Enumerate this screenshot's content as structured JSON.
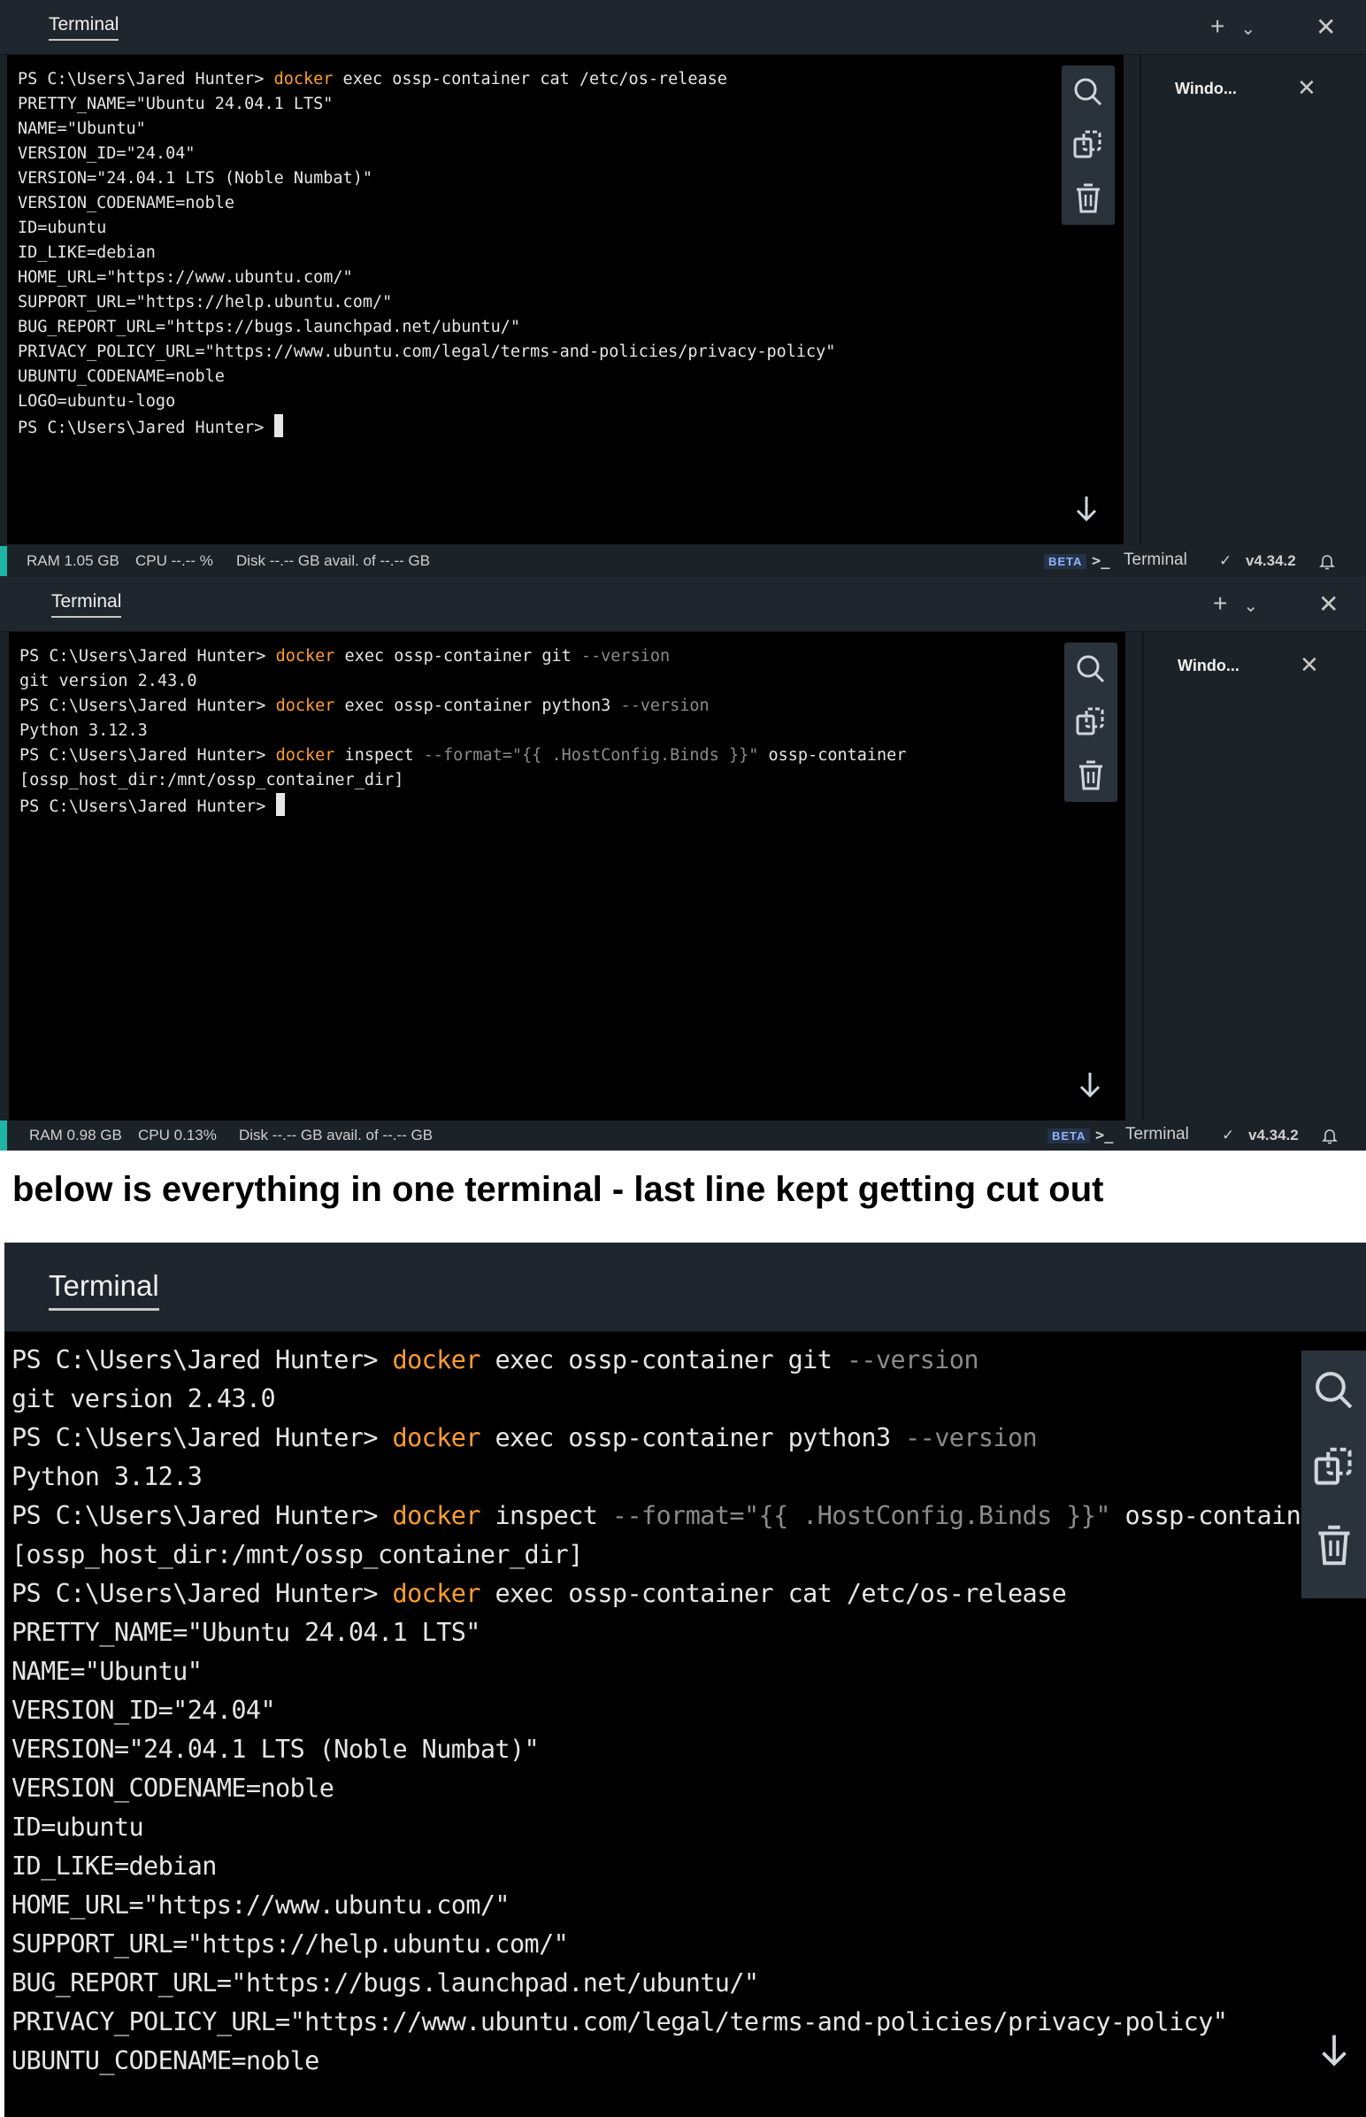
{
  "window1": {
    "tab_title": "Terminal",
    "side_panel_title": "Windo...",
    "lines": [
      [
        {
          "t": "PS C:\\Users\\Jared Hunter> "
        },
        {
          "t": "docker",
          "c": "kw"
        },
        {
          "t": " exec ossp-container cat /etc/os-release"
        }
      ],
      [
        {
          "t": "PRETTY_NAME=\"Ubuntu 24.04.1 LTS\""
        }
      ],
      [
        {
          "t": "NAME=\"Ubuntu\""
        }
      ],
      [
        {
          "t": "VERSION_ID=\"24.04\""
        }
      ],
      [
        {
          "t": "VERSION=\"24.04.1 LTS (Noble Numbat)\""
        }
      ],
      [
        {
          "t": "VERSION_CODENAME=noble"
        }
      ],
      [
        {
          "t": "ID=ubuntu"
        }
      ],
      [
        {
          "t": "ID_LIKE=debian"
        }
      ],
      [
        {
          "t": "HOME_URL=\"https://www.ubuntu.com/\""
        }
      ],
      [
        {
          "t": "SUPPORT_URL=\"https://help.ubuntu.com/\""
        }
      ],
      [
        {
          "t": "BUG_REPORT_URL=\"https://bugs.launchpad.net/ubuntu/\""
        }
      ],
      [
        {
          "t": "PRIVACY_POLICY_URL=\"https://www.ubuntu.com/legal/terms-and-policies/privacy-policy\""
        }
      ],
      [
        {
          "t": "UBUNTU_CODENAME=noble"
        }
      ],
      [
        {
          "t": "LOGO=ubuntu-logo"
        }
      ],
      [
        {
          "t": "PS C:\\Users\\Jared Hunter> "
        },
        {
          "cursor": true
        }
      ]
    ],
    "status": {
      "ram": "RAM 1.05 GB",
      "cpu": "CPU --.-- %",
      "disk": "Disk --.-- GB avail. of --.-- GB",
      "beta": "BETA",
      "terminal": "Terminal",
      "version": "v4.34.2"
    }
  },
  "window2": {
    "tab_title": "Terminal",
    "side_panel_title": "Windo...",
    "lines": [
      [
        {
          "t": "PS C:\\Users\\Jared Hunter> "
        },
        {
          "t": "docker",
          "c": "kw"
        },
        {
          "t": " exec ossp-container git "
        },
        {
          "t": "--version",
          "c": "flag"
        }
      ],
      [
        {
          "t": "git version 2.43.0"
        }
      ],
      [
        {
          "t": "PS C:\\Users\\Jared Hunter> "
        },
        {
          "t": "docker",
          "c": "kw"
        },
        {
          "t": " exec ossp-container python3 "
        },
        {
          "t": "--version",
          "c": "flag"
        }
      ],
      [
        {
          "t": "Python 3.12.3"
        }
      ],
      [
        {
          "t": "PS C:\\Users\\Jared Hunter> "
        },
        {
          "t": "docker",
          "c": "kw"
        },
        {
          "t": " inspect "
        },
        {
          "t": "--format=\"{{ .HostConfig.Binds }}\"",
          "c": "flag"
        },
        {
          "t": " ossp-container"
        }
      ],
      [
        {
          "t": "[ossp_host_dir:/mnt/ossp_container_dir]"
        }
      ],
      [
        {
          "t": "PS C:\\Users\\Jared Hunter> "
        },
        {
          "cursor": true
        }
      ]
    ],
    "status": {
      "ram": "RAM 0.98 GB",
      "cpu": "CPU 0.13%",
      "disk": "Disk --.-- GB avail. of --.-- GB",
      "beta": "BETA",
      "terminal": "Terminal",
      "version": "v4.34.2"
    }
  },
  "caption": "below is everything in one terminal - last line kept getting cut out",
  "window3": {
    "tab_title": "Terminal",
    "lines": [
      [
        {
          "t": "PS C:\\Users\\Jared Hunter> "
        },
        {
          "t": "docker",
          "c": "kw"
        },
        {
          "t": " exec ossp-container git "
        },
        {
          "t": "--version",
          "c": "flag"
        }
      ],
      [
        {
          "t": "git version 2.43.0"
        }
      ],
      [
        {
          "t": "PS C:\\Users\\Jared Hunter> "
        },
        {
          "t": "docker",
          "c": "kw"
        },
        {
          "t": " exec ossp-container python3 "
        },
        {
          "t": "--version",
          "c": "flag"
        }
      ],
      [
        {
          "t": "Python 3.12.3"
        }
      ],
      [
        {
          "t": "PS C:\\Users\\Jared Hunter> "
        },
        {
          "t": "docker",
          "c": "kw"
        },
        {
          "t": " inspect "
        },
        {
          "t": "--format=\"{{ .HostConfig.Binds }}\"",
          "c": "flag"
        },
        {
          "t": " ossp-container"
        }
      ],
      [
        {
          "t": "[ossp_host_dir:/mnt/ossp_container_dir]"
        }
      ],
      [
        {
          "t": "PS C:\\Users\\Jared Hunter> "
        },
        {
          "t": "docker",
          "c": "kw"
        },
        {
          "t": " exec ossp-container cat /etc/os-release"
        }
      ],
      [
        {
          "t": "PRETTY_NAME=\"Ubuntu 24.04.1 LTS\""
        }
      ],
      [
        {
          "t": "NAME=\"Ubuntu\""
        }
      ],
      [
        {
          "t": "VERSION_ID=\"24.04\""
        }
      ],
      [
        {
          "t": "VERSION=\"24.04.1 LTS (Noble Numbat)\""
        }
      ],
      [
        {
          "t": "VERSION_CODENAME=noble"
        }
      ],
      [
        {
          "t": "ID=ubuntu"
        }
      ],
      [
        {
          "t": "ID_LIKE=debian"
        }
      ],
      [
        {
          "t": "HOME_URL=\"https://www.ubuntu.com/\""
        }
      ],
      [
        {
          "t": "SUPPORT_URL=\"https://help.ubuntu.com/\""
        }
      ],
      [
        {
          "t": "BUG_REPORT_URL=\"https://bugs.launchpad.net/ubuntu/\""
        }
      ],
      [
        {
          "t": "PRIVACY_POLICY_URL=\"https://www.ubuntu.com/legal/terms-and-policies/privacy-policy\""
        }
      ],
      [
        {
          "t": "UBUNTU_CODENAME=noble"
        }
      ]
    ]
  },
  "colors": {
    "command_keyword": "#ff9d2e",
    "flag_text": "#8a8a8a",
    "status_accent": "#1fb5a5"
  },
  "icons": [
    "add-icon",
    "chevron-down-icon",
    "close-icon",
    "search-icon",
    "copy-icon",
    "trash-icon",
    "arrow-down-icon",
    "terminal-prompt-icon",
    "checkmark-icon",
    "bell-icon"
  ]
}
